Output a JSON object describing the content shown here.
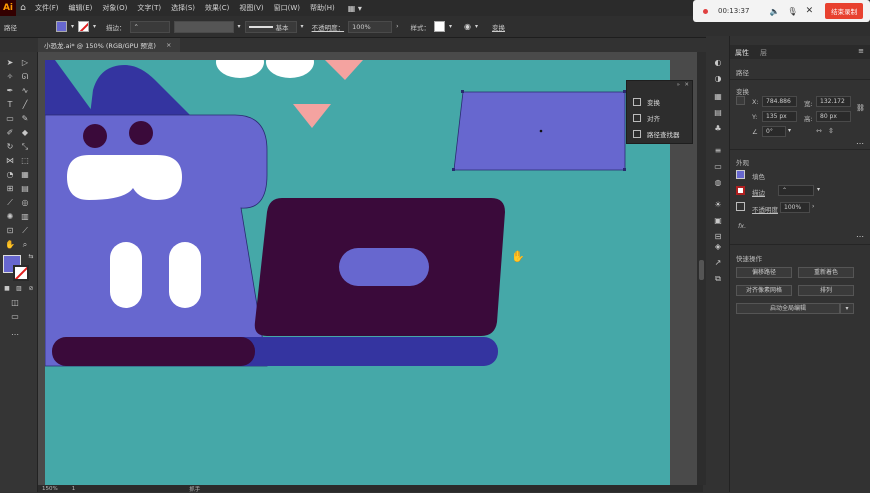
{
  "app": {
    "logo": "Ai"
  },
  "menu": [
    "文件(F)",
    "编辑(E)",
    "对象(O)",
    "文字(T)",
    "选择(S)",
    "效果(C)",
    "视图(V)",
    "窗口(W)",
    "帮助(H)"
  ],
  "control_bar": {
    "label": "路径",
    "stroke_label": "描边：",
    "stroke_style": "基本",
    "opacity_label": "不透明度：",
    "opacity_value": "100%",
    "style_label": "样式：",
    "transform_label": "变换",
    "fill_color": "#6767cf"
  },
  "document_tab": {
    "title": "小恐龙.ai* @ 150% (RGB/GPU 预览)",
    "close": "×"
  },
  "recorder": {
    "time": "00:13:37",
    "stop_label": "结束录制"
  },
  "right_panel": {
    "tab_properties": "属性",
    "tab_layers": "层",
    "path_label": "路径",
    "transform_label": "变换",
    "x_label": "X:",
    "x_value": "784.886",
    "y_label": "Y:",
    "y_value": "135 px",
    "w_label": "宽:",
    "w_value": "132.172",
    "h_label": "高:",
    "h_value": "80 px",
    "angle_value": "0°",
    "appearance_label": "外观",
    "fill_label": "填色",
    "stroke_label": "描边",
    "opacity_label": "不透明度",
    "opacity_value": "100%",
    "fx_label": "fx.",
    "quick_actions_label": "快速操作",
    "btn_offset_path": "偏移路径",
    "btn_recolor": "重新着色",
    "btn_pixel_align": "对齐像素网格",
    "btn_arrange": "排列",
    "btn_global_edit": "启动全局编辑"
  },
  "float_panel": {
    "items": [
      "变换",
      "对齐",
      "路径查找器"
    ]
  },
  "status": {
    "zoom": "150%",
    "page": "1",
    "tool": "抓手"
  },
  "colors": {
    "canvas": "#45a8a8",
    "dino": "#6767cf",
    "dark": "#3a0a3a",
    "navy": "#3434a0",
    "pink": "#f4a3a0"
  }
}
